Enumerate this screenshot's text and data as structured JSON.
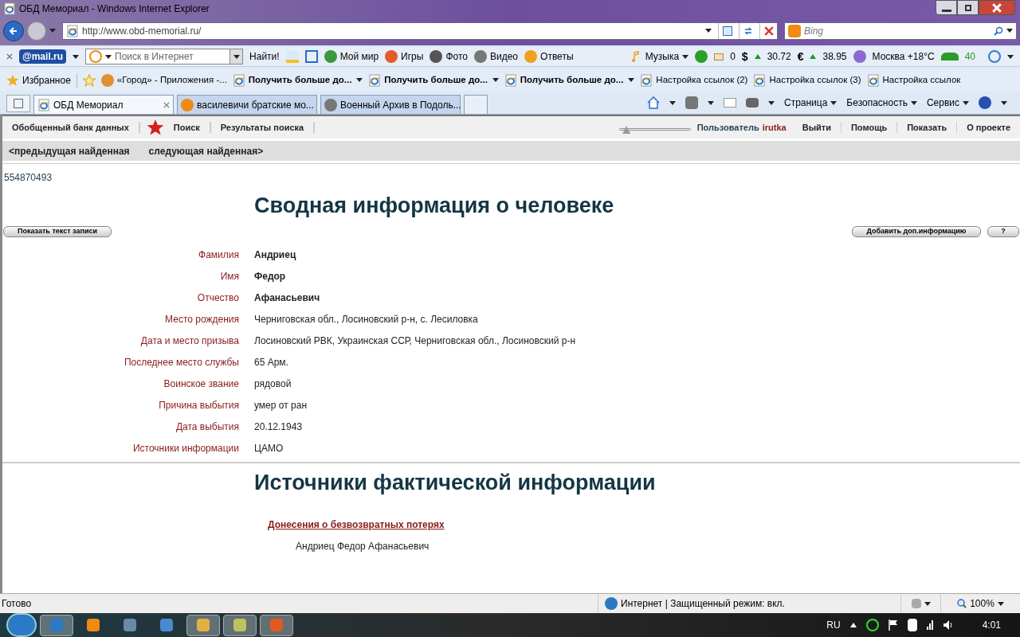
{
  "window": {
    "title": "ОБД Мемориал - Windows Internet Explorer"
  },
  "address_bar": {
    "url": "http://www.obd-memorial.ru/",
    "search_placeholder": "Bing"
  },
  "mail_toolbar": {
    "logo": "@mail.ru",
    "search_placeholder": "Поиск в Интернет",
    "find_button": "Найти!",
    "items": [
      {
        "label": "Мой мир"
      },
      {
        "label": "Игры"
      },
      {
        "label": "Фото"
      },
      {
        "label": "Видео"
      },
      {
        "label": "Ответы"
      }
    ],
    "music": "Музыка",
    "mail_count": "0",
    "usd_sign": "$",
    "usd": "30.72",
    "eur_sign": "€",
    "eur": "38.95",
    "weather": "Москва +18°C",
    "traffic": "40"
  },
  "favorites_bar": {
    "label": "Избранное",
    "links": [
      {
        "label": "«Город» - Приложения -...",
        "bold": false,
        "dropdown": false
      },
      {
        "label": "Получить больше до...",
        "bold": true,
        "dropdown": true
      },
      {
        "label": "Получить больше до...",
        "bold": true,
        "dropdown": true
      },
      {
        "label": "Получить больше до...",
        "bold": true,
        "dropdown": true
      },
      {
        "label": "Настройка ссылок (2)",
        "bold": false,
        "dropdown": false
      },
      {
        "label": "Настройка ссылок (3)",
        "bold": false,
        "dropdown": false
      },
      {
        "label": "Настройка ссылок",
        "bold": false,
        "dropdown": false
      }
    ]
  },
  "tabs": [
    {
      "label": "ОБД Мемориал",
      "selected": true
    },
    {
      "label": "василевичи братские мо...",
      "selected": false
    },
    {
      "label": "Военный Архив в Подоль...",
      "selected": false
    }
  ],
  "command_bar": [
    "Страница",
    "Безопасность",
    "Сервис"
  ],
  "site_nav": {
    "left": [
      "Обобщенный банк данных",
      "Поиск",
      "Результаты поиска"
    ],
    "slider": {
      "level": 0.05
    },
    "user_label": "Пользователь",
    "user_name": "irutka",
    "right": [
      "Выйти",
      "Помощь",
      "Показать",
      "О проекте"
    ]
  },
  "record_nav": {
    "previous": "<предыдущая найденная",
    "next": "следующая найденная>"
  },
  "record_id": "554870493",
  "title": "Сводная информация о человеке",
  "buttons": {
    "show_text": "Показать текст записи",
    "add_info": "Добавить доп.информацию",
    "help": "?"
  },
  "fields": [
    {
      "label": "Фамилия",
      "value": "Андриец",
      "bold": true
    },
    {
      "label": "Имя",
      "value": "Федор",
      "bold": true
    },
    {
      "label": "Отчество",
      "value": "Афанасьевич",
      "bold": true
    },
    {
      "label": "Место рождения",
      "value": "Черниговская обл., Лосиновский р-н, с. Лесиловка",
      "bold": false
    },
    {
      "label": "Дата и место призыва",
      "value": "Лосиновский РВК, Украинская ССР, Черниговская обл., Лосиновский р-н",
      "bold": false
    },
    {
      "label": "Последнее место службы",
      "value": "65 Арм.",
      "bold": false
    },
    {
      "label": "Воинское звание",
      "value": "рядовой",
      "bold": false
    },
    {
      "label": "Причина выбытия",
      "value": "умер от ран",
      "bold": false
    },
    {
      "label": "Дата выбытия",
      "value": "20.12.1943",
      "bold": false
    },
    {
      "label": "Источники информации",
      "value": "ЦАМО",
      "bold": false
    }
  ],
  "sources": {
    "title": "Источники фактической информации",
    "link": "Донесения о безвозвратных потерях",
    "person": "Андриец Федор Афанасьевич"
  },
  "status_bar": {
    "text": "Готово",
    "zone": "Интернет | Защищенный режим: вкл.",
    "zoom": "100%"
  },
  "taskbar": {
    "language": "RU",
    "time": "4:01"
  }
}
